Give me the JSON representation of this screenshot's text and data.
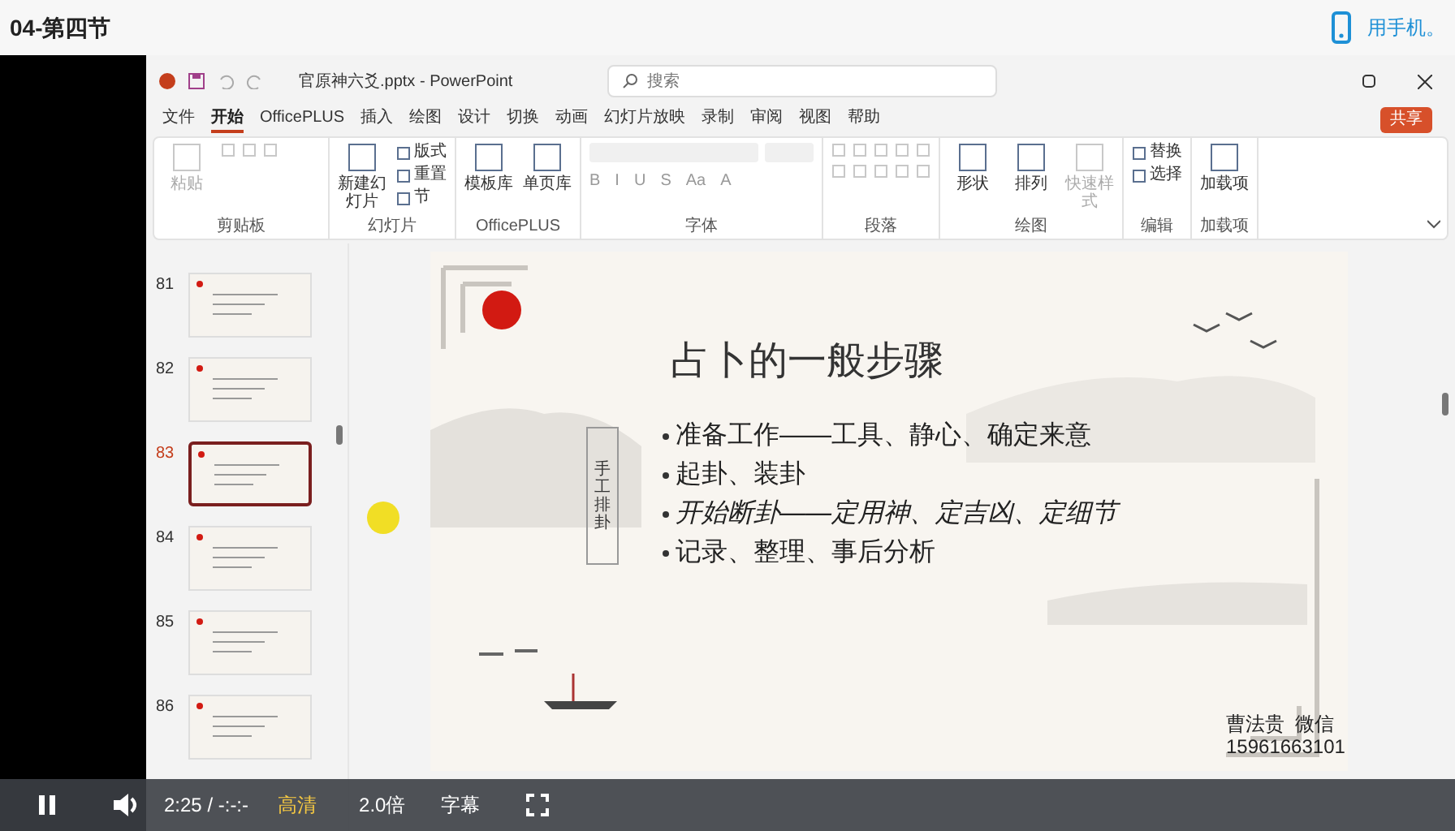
{
  "page_title": "04-第四节",
  "phone_link": "用手机。",
  "app": {
    "file_title": "官原神六爻.pptx - PowerPoint",
    "search_placeholder": "搜索",
    "share_button": "共享",
    "tabs": [
      {
        "label": "文件",
        "selected": false
      },
      {
        "label": "开始",
        "selected": true
      },
      {
        "label": "OfficePLUS",
        "selected": false
      },
      {
        "label": "插入",
        "selected": false
      },
      {
        "label": "绘图",
        "selected": false
      },
      {
        "label": "设计",
        "selected": false
      },
      {
        "label": "切换",
        "selected": false
      },
      {
        "label": "动画",
        "selected": false
      },
      {
        "label": "幻灯片放映",
        "selected": false
      },
      {
        "label": "录制",
        "selected": false
      },
      {
        "label": "审阅",
        "selected": false
      },
      {
        "label": "视图",
        "selected": false
      },
      {
        "label": "帮助",
        "selected": false
      }
    ],
    "ribbon_groups": [
      {
        "label": "剪贴板",
        "items": [
          {
            "kind": "large",
            "label": "粘贴",
            "disabled": true
          },
          {
            "kind": "icons"
          }
        ]
      },
      {
        "label": "幻灯片",
        "items": [
          {
            "kind": "large",
            "label": "新建幻灯片",
            "disabled": false
          },
          {
            "kind": "stack",
            "entries": [
              "版式",
              "重置",
              "节"
            ]
          }
        ]
      },
      {
        "label": "OfficePLUS",
        "items": [
          {
            "kind": "large",
            "label": "模板库",
            "disabled": false
          },
          {
            "kind": "large",
            "label": "单页库",
            "disabled": false
          }
        ]
      },
      {
        "label": "字体",
        "items": [
          {
            "kind": "font",
            "glyphs": [
              "B",
              "I",
              "U",
              "S",
              "Aa",
              "A"
            ]
          }
        ]
      },
      {
        "label": "段落",
        "items": [
          {
            "kind": "icons"
          }
        ]
      },
      {
        "label": "绘图",
        "items": [
          {
            "kind": "large",
            "label": "形状",
            "disabled": false
          },
          {
            "kind": "large",
            "label": "排列",
            "disabled": false
          },
          {
            "kind": "large",
            "label": "快速样式",
            "disabled": true
          }
        ]
      },
      {
        "label": "编辑",
        "items": [
          {
            "kind": "stack",
            "entries": [
              "替换",
              "选择"
            ]
          }
        ]
      },
      {
        "label": "加载项",
        "items": [
          {
            "kind": "large",
            "label": "加载项",
            "disabled": false
          }
        ]
      }
    ]
  },
  "slides": [
    {
      "number": "81",
      "selected": false
    },
    {
      "number": "82",
      "selected": false
    },
    {
      "number": "83",
      "selected": true
    },
    {
      "number": "84",
      "selected": false
    },
    {
      "number": "85",
      "selected": false
    },
    {
      "number": "86",
      "selected": false
    }
  ],
  "slide": {
    "title": "占卜的一般步骤",
    "vertical_label": "手工排卦",
    "bullets": [
      {
        "text": "准备工作——工具、静心、确定来意",
        "italic": false
      },
      {
        "text": "起卦、装卦",
        "italic": false
      },
      {
        "text": "开始断卦——定用神、定吉凶、定细节",
        "italic": true
      },
      {
        "text": "记录、整理、事后分析",
        "italic": false
      }
    ],
    "footer_name": "曹法贵  微信",
    "footer_phone": "15961663101"
  },
  "player": {
    "playing": true,
    "time": "2:25 / -:-:-",
    "quality": "高清",
    "speed": "2.0倍",
    "subtitles": "字幕"
  }
}
